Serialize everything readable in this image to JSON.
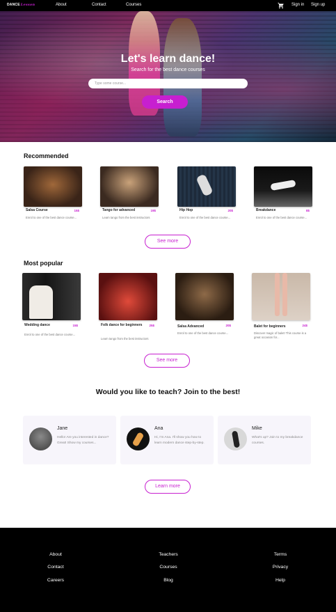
{
  "nav": {
    "logo": "DANCE",
    "logo_script": "Lesson",
    "about": "About",
    "contact": "Contact",
    "courses": "Courses",
    "cart_icon": "cart-icon",
    "signin": "Sign in",
    "signup": "Sign up"
  },
  "hero": {
    "title": "Let's learn dance!",
    "subtitle": "Search for the best dance courses",
    "search_placeholder": "Type some course...",
    "search_button": "Search"
  },
  "recommended": {
    "title": "Recommended",
    "cards": [
      {
        "name": "Salsa Course",
        "price": "15$",
        "desc": "Enrol to one of the best dance course..."
      },
      {
        "name": "Tango for advanced",
        "price": "19$",
        "desc": "Learn tango from the best instructors"
      },
      {
        "name": "Hip Hop",
        "price": "20$",
        "desc": "Enrol to one of the best dance course..."
      },
      {
        "name": "Breakdance",
        "price": "8$",
        "desc": "Enrol to one of the best dance course..."
      }
    ],
    "see_more": "See more"
  },
  "popular": {
    "title": "Most popular",
    "cards": [
      {
        "name": "Wedding dance",
        "price": "15$",
        "desc": "Enrol to one of the best dance course..."
      },
      {
        "name": "Folk dance for beginners",
        "price": "25$",
        "desc": "Learn tango from the best instructors"
      },
      {
        "name": "Salsa Advanced",
        "price": "20$",
        "desc": "Enrol to one of the best dance course..."
      },
      {
        "name": "Balet for beginners",
        "price": "24$",
        "desc": "Discover magic of balet! This course is a great occasion for..."
      }
    ],
    "see_more": "See more"
  },
  "teach": {
    "title": "Would you like to teach? Join to the best!",
    "teachers": [
      {
        "name": "Jane",
        "desc": "Hello! Are you interested in dance? Great! Show my courses..."
      },
      {
        "name": "Ana",
        "desc": "Hi, I'm Ana. I'll show you how to learn modern dance step-by-step."
      },
      {
        "name": "Mike",
        "desc": "What's up? Join to my breakdance courses."
      }
    ],
    "learn_more": "Learn more"
  },
  "footer": {
    "col1": [
      "About",
      "Contact",
      "Careers"
    ],
    "col2": [
      "Teachers",
      "Courses",
      "Blog"
    ],
    "col3": [
      "Terms",
      "Privacy",
      "Help"
    ]
  },
  "colors": {
    "accent": "#c71fd0",
    "footer_bg": "#000000",
    "nav_bg": "#000000"
  }
}
